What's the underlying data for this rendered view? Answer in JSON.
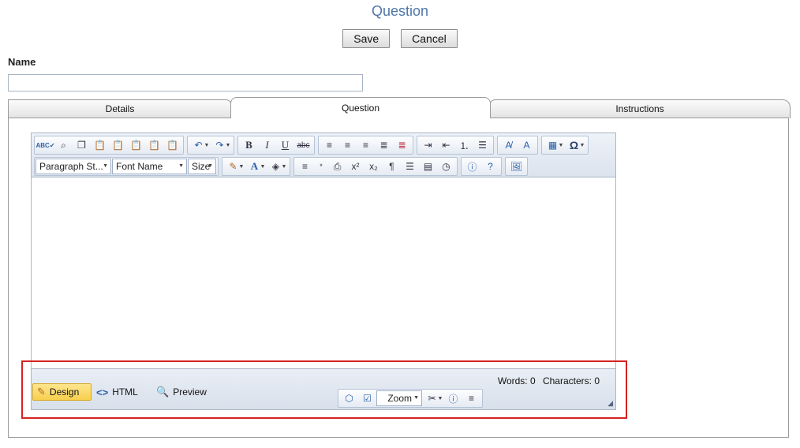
{
  "page": {
    "title": "Question",
    "save_label": "Save",
    "cancel_label": "Cancel"
  },
  "name_field": {
    "label": "Name",
    "value": "",
    "placeholder": ""
  },
  "tabs": [
    {
      "label": "Details",
      "selected": false
    },
    {
      "label": "Question",
      "selected": true
    },
    {
      "label": "Instructions",
      "selected": false
    }
  ],
  "editor": {
    "toolbar_row1_icons": [
      "spellcheck-icon",
      "find-replace-icon",
      "copy-icon",
      "paste-icon",
      "paste-from-word-icon",
      "paste-plain-text-icon",
      "paste-as-html-icon",
      "paste-html-icon",
      "undo-icon",
      "redo-icon",
      "bold-icon",
      "italic-icon",
      "underline-icon",
      "strikethrough-icon",
      "align-left-icon",
      "align-center-icon",
      "align-right-icon",
      "justify-icon",
      "remove-alignment-icon",
      "indent-icon",
      "outdent-icon",
      "numbered-list-icon",
      "bulleted-list-icon",
      "format-stripper-icon",
      "text-direction-icon",
      "table-icon",
      "symbol-icon"
    ],
    "paragraph_style": "Paragraph St...",
    "font_name": "Font Name",
    "font_size": "Size",
    "symbol_glyph": "Ω",
    "content": "",
    "modes": {
      "design": "Design",
      "html": "HTML",
      "preview": "Preview",
      "active": "Design"
    },
    "zoom_label": "Zoom",
    "words": "Words: 0",
    "characters": "Characters: 0"
  },
  "colors": {
    "title": "#4f76a8",
    "highlight_border": "#d62222",
    "active_mode": "#f8cf4d"
  }
}
